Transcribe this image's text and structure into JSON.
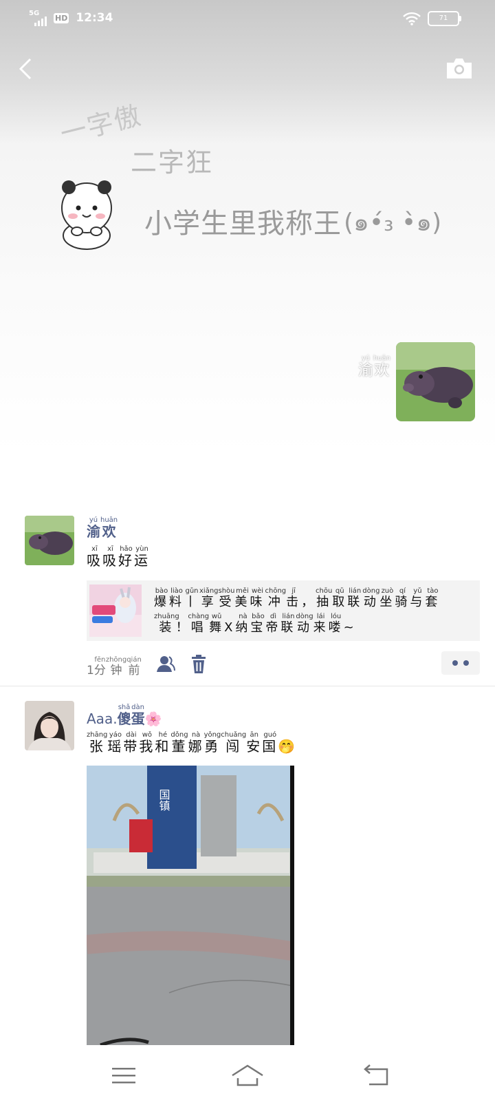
{
  "status_bar": {
    "network": "5G",
    "hd": "HD",
    "time": "12:34",
    "battery": "71"
  },
  "cover": {
    "art_line1": "一字傲",
    "art_line2": "二字狂",
    "art_line3": "小学生里我称王",
    "art_face": "(๑•́₃ •̀๑)"
  },
  "owner": {
    "name_ruby": [
      {
        "c": "渝",
        "p": "yú"
      },
      {
        "c": "欢",
        "p": "huān"
      }
    ]
  },
  "posts": [
    {
      "name_ruby": [
        {
          "c": "渝",
          "p": "yú"
        },
        {
          "c": "欢",
          "p": "huān"
        }
      ],
      "text_ruby": [
        {
          "c": "吸",
          "p": "xī"
        },
        {
          "c": "吸",
          "p": "xī"
        },
        {
          "c": "好",
          "p": "hǎo"
        },
        {
          "c": "运",
          "p": "yùn"
        }
      ],
      "share": {
        "line1": [
          {
            "c": "爆",
            "p": "bào"
          },
          {
            "c": "料",
            "p": "liào"
          },
          {
            "c": "丨",
            "p": "gǔn"
          },
          {
            "c": "享",
            "p": "xiǎng"
          },
          {
            "c": "受",
            "p": "shòu"
          },
          {
            "c": "美",
            "p": "měi"
          },
          {
            "c": "味",
            "p": "wèi"
          },
          {
            "c": "冲",
            "p": "chōng"
          },
          {
            "c": "击",
            "p": "jī"
          },
          {
            "c": "，",
            "p": ""
          },
          {
            "c": "抽",
            "p": "chōu"
          },
          {
            "c": "取",
            "p": "qǔ"
          },
          {
            "c": "联",
            "p": "lián"
          },
          {
            "c": "动",
            "p": "dòng"
          },
          {
            "c": "坐",
            "p": "zuò"
          },
          {
            "c": "骑",
            "p": "qí"
          },
          {
            "c": "与",
            "p": "yǔ"
          },
          {
            "c": "套",
            "p": "tào"
          }
        ],
        "line2": [
          {
            "c": "装",
            "p": "zhuāng"
          },
          {
            "c": "！",
            "p": ""
          },
          {
            "c": "唱",
            "p": "chàng"
          },
          {
            "c": "舞",
            "p": "wǔ"
          },
          {
            "c": "X",
            "p": ""
          },
          {
            "c": "纳",
            "p": "nà"
          },
          {
            "c": "宝",
            "p": "bǎo"
          },
          {
            "c": "帝",
            "p": "dì"
          },
          {
            "c": "联",
            "p": "lián"
          },
          {
            "c": "动",
            "p": "dòng"
          },
          {
            "c": "来",
            "p": "lái"
          },
          {
            "c": "喽",
            "p": "lóu"
          },
          {
            "c": "~",
            "p": ""
          }
        ]
      },
      "time_ruby": [
        {
          "c": "1",
          "p": ""
        },
        {
          "c": "分",
          "p": "fēn"
        },
        {
          "c": "钟",
          "p": "zhōng"
        },
        {
          "c": "前",
          "p": "qián"
        }
      ]
    },
    {
      "name_prefix": "Aaa.",
      "name_ruby": [
        {
          "c": "傻",
          "p": "shǎ"
        },
        {
          "c": "蛋",
          "p": "dàn"
        }
      ],
      "name_emoji": "🌸",
      "text_ruby": [
        {
          "c": "张",
          "p": "zhāng"
        },
        {
          "c": "瑶",
          "p": "yáo"
        },
        {
          "c": "带",
          "p": "dài"
        },
        {
          "c": "我",
          "p": "wǒ"
        },
        {
          "c": "和",
          "p": "hé"
        },
        {
          "c": "董",
          "p": "dǒng"
        },
        {
          "c": "娜",
          "p": "nà"
        },
        {
          "c": "勇",
          "p": "yǒng"
        },
        {
          "c": "闯",
          "p": "chuǎng"
        },
        {
          "c": "安",
          "p": "ān"
        },
        {
          "c": "国",
          "p": "guó"
        }
      ],
      "text_emoji": "🤭",
      "photo_sign_text": "国镇"
    }
  ],
  "colors": {
    "name_blue": "#51608a",
    "card_bg": "#f3f3f3"
  }
}
